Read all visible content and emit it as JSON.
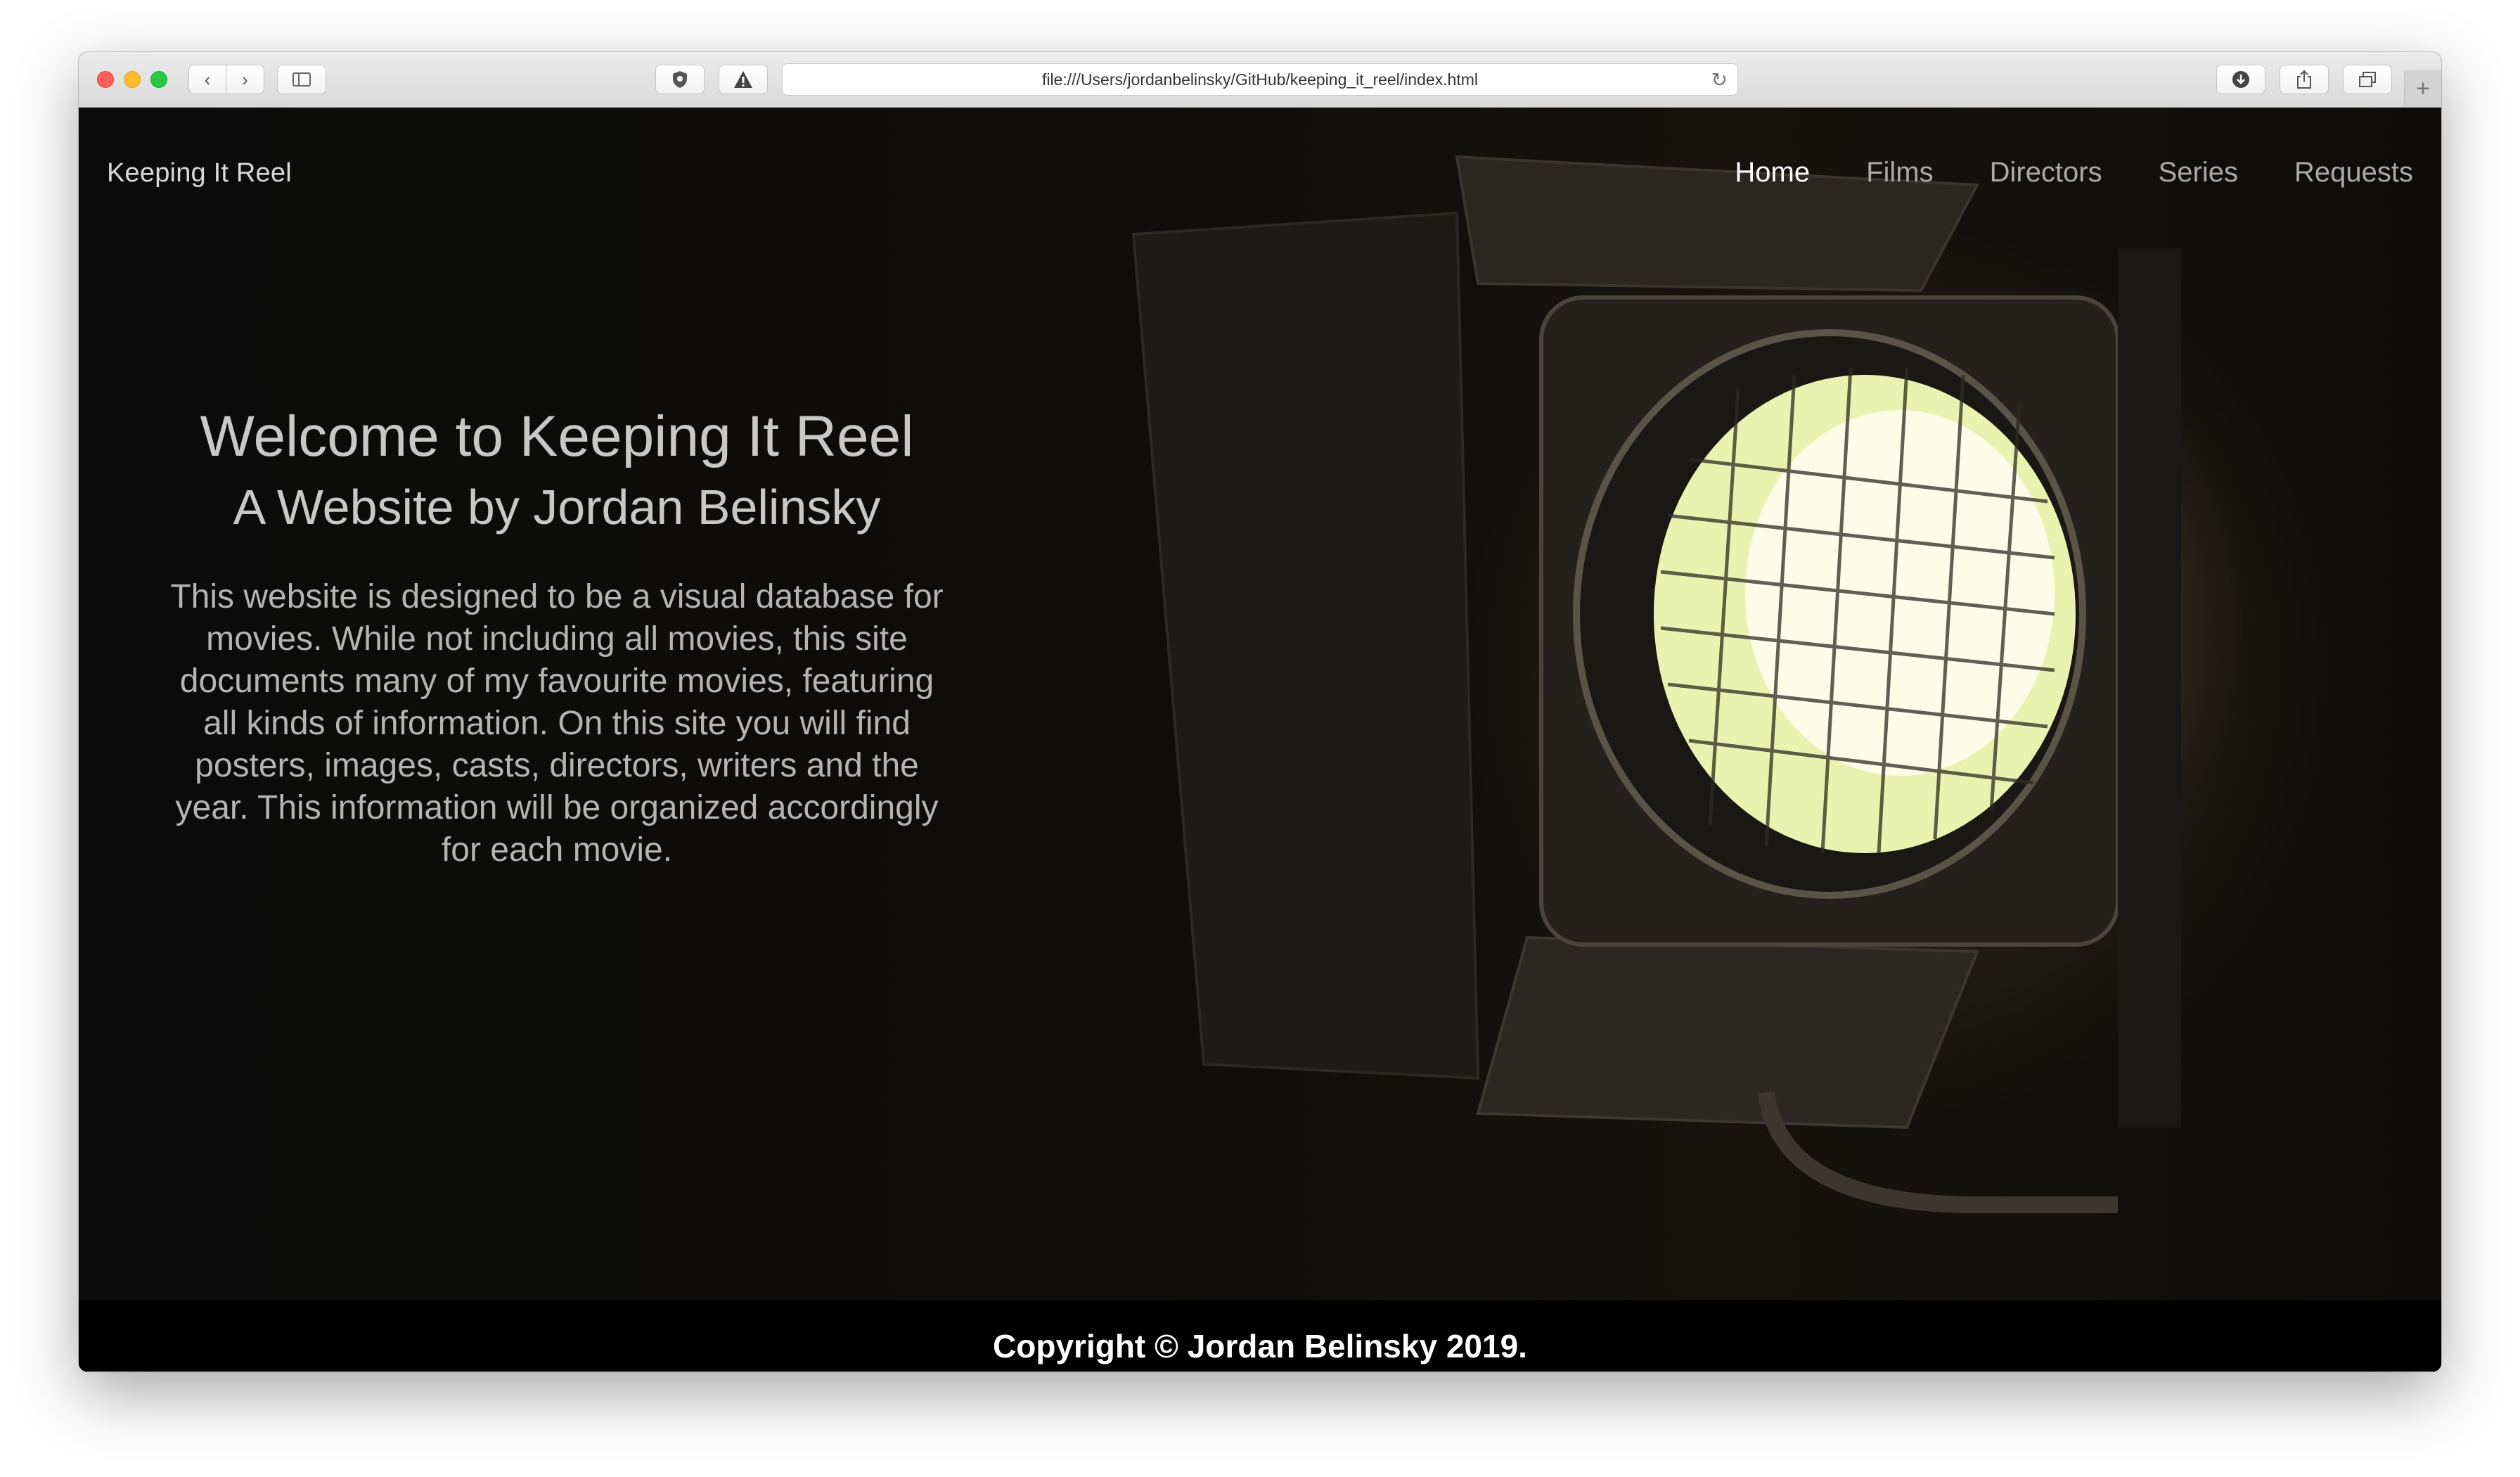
{
  "browser": {
    "address_url": "file:///Users/jordanbelinsky/GitHub/keeping_it_reel/index.html",
    "icons": {
      "back": "chevron-left-icon",
      "forward": "chevron-right-icon",
      "sidebar": "sidebar-icon",
      "privacy": "shield-icon",
      "warning": "warning-icon",
      "reload": "reload-icon",
      "download": "download-icon",
      "share": "share-icon",
      "tabs": "tabs-icon",
      "new_tab": "plus-icon"
    }
  },
  "nav": {
    "brand": "Keeping It Reel",
    "links": [
      {
        "label": "Home",
        "active": true
      },
      {
        "label": "Films",
        "active": false
      },
      {
        "label": "Directors",
        "active": false
      },
      {
        "label": "Series",
        "active": false
      },
      {
        "label": "Requests",
        "active": false
      }
    ]
  },
  "hero": {
    "title": "Welcome to Keeping It Reel",
    "subtitle": "A Website by Jordan Belinsky",
    "description": "This website is designed to be a visual database for movies. While not including all movies, this site documents many of my favourite movies, featuring all kinds of information. On this site you will find posters, images, casts, directors, writers and the year. This information will be organized accordingly for each movie."
  },
  "footer": {
    "copyright": "Copyright © Jordan Belinsky 2019."
  },
  "colors": {
    "page_background": "#0b0b0b",
    "nav_active": "#ffffff",
    "nav_inactive": "#a9a9a9",
    "footer_background": "#000000"
  }
}
